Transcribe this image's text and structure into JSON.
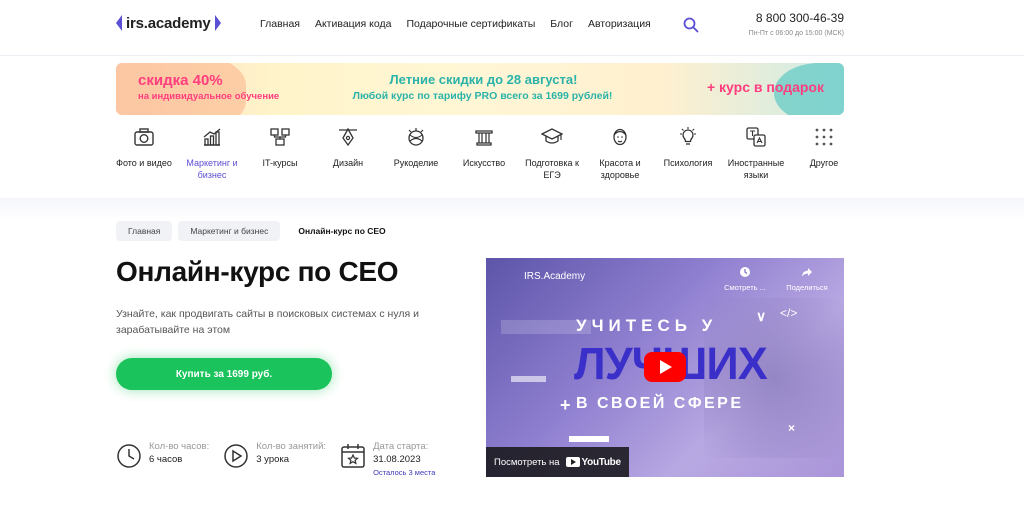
{
  "header": {
    "logo_text": "irs.academy",
    "nav": [
      "Главная",
      "Активация кода",
      "Подарочные сертификаты",
      "Блог",
      "Авторизация"
    ],
    "phone": "8 800 300-46-39",
    "hours": "Пн-Пт с 06:00 до 15:00 (МСК)"
  },
  "banner": {
    "left_line1": "скидка 40%",
    "left_line2": "на индивидуальное обучение",
    "mid_line1": "Летние скидки до 28 августа!",
    "mid_line2": "Любой курс по тарифу PRO всего за 1699 рублей!",
    "right_text": "+ курс в подарок"
  },
  "categories": [
    {
      "label": "Фото и видео",
      "icon": "camera-icon"
    },
    {
      "label": "Маркетинг и бизнес",
      "icon": "chart-icon",
      "active": true
    },
    {
      "label": "IT-курсы",
      "icon": "network-icon"
    },
    {
      "label": "Дизайн",
      "icon": "pen-tool-icon"
    },
    {
      "label": "Рукоделие",
      "icon": "yarn-icon"
    },
    {
      "label": "Искусство",
      "icon": "column-icon"
    },
    {
      "label": "Подготовка к ЕГЭ",
      "icon": "graduation-cap-icon"
    },
    {
      "label": "Красота и здоровье",
      "icon": "face-icon"
    },
    {
      "label": "Психология",
      "icon": "lightbulb-icon"
    },
    {
      "label": "Иностранные языки",
      "icon": "translate-icon"
    },
    {
      "label": "Другое",
      "icon": "grid-dots-icon"
    }
  ],
  "breadcrumbs": [
    "Главная",
    "Маркетинг и бизнес",
    "Онлайн-курс по CEO"
  ],
  "course": {
    "title": "Онлайн-курс по CEO",
    "description": "Узнайте, как продвигать сайты в поисковых системах с нуля и зарабатывайте на этом",
    "buy_label": "Купить за 1699 руб."
  },
  "stats": [
    {
      "title": "Кол-во часов:",
      "value": "6 часов",
      "icon": "clock-icon"
    },
    {
      "title": "Кол-во занятий:",
      "value": "3 урока",
      "icon": "play-circle-icon"
    },
    {
      "title": "Дата старта:",
      "value": "31.08.2023",
      "extra": "Осталось 3 места",
      "icon": "calendar-star-icon"
    }
  ],
  "video": {
    "channel": "IRS.Academy",
    "watch_later": "Смотреть ...",
    "share": "Поделиться",
    "line1": "УЧИТЕСЬ У",
    "line2": "ЛУЧШИХ",
    "line3": "В СВОЕЙ СФЕРЕ",
    "watch_on": "Посмотреть на",
    "youtube": "YouTube"
  },
  "colors": {
    "accent": "#5b4fd6",
    "buy_button": "#1ac35b",
    "banner_pink": "#ff3d7f",
    "banner_teal": "#2bb3a9"
  }
}
